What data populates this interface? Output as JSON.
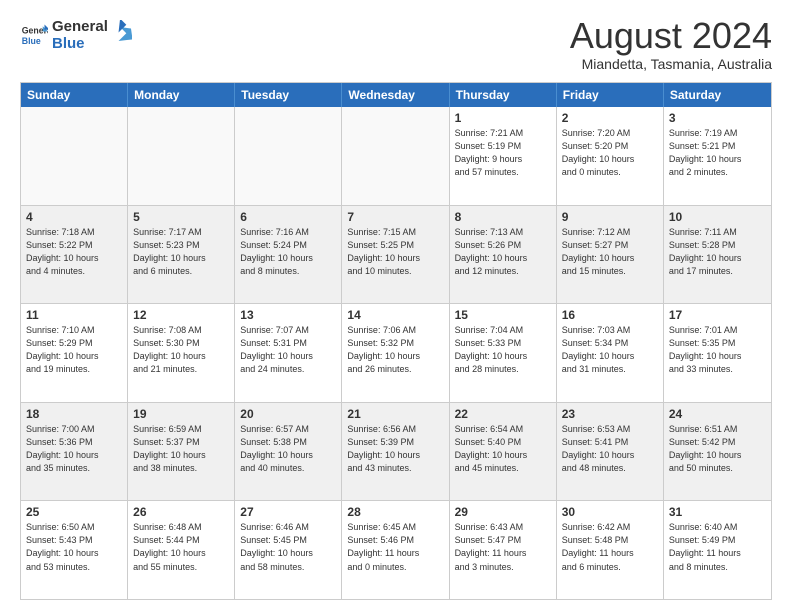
{
  "header": {
    "logo_line1": "General",
    "logo_line2": "Blue",
    "month_title": "August 2024",
    "location": "Miandetta, Tasmania, Australia"
  },
  "days_of_week": [
    "Sunday",
    "Monday",
    "Tuesday",
    "Wednesday",
    "Thursday",
    "Friday",
    "Saturday"
  ],
  "weeks": [
    [
      {
        "day": "",
        "text": ""
      },
      {
        "day": "",
        "text": ""
      },
      {
        "day": "",
        "text": ""
      },
      {
        "day": "",
        "text": ""
      },
      {
        "day": "1",
        "text": "Sunrise: 7:21 AM\nSunset: 5:19 PM\nDaylight: 9 hours\nand 57 minutes."
      },
      {
        "day": "2",
        "text": "Sunrise: 7:20 AM\nSunset: 5:20 PM\nDaylight: 10 hours\nand 0 minutes."
      },
      {
        "day": "3",
        "text": "Sunrise: 7:19 AM\nSunset: 5:21 PM\nDaylight: 10 hours\nand 2 minutes."
      }
    ],
    [
      {
        "day": "4",
        "text": "Sunrise: 7:18 AM\nSunset: 5:22 PM\nDaylight: 10 hours\nand 4 minutes."
      },
      {
        "day": "5",
        "text": "Sunrise: 7:17 AM\nSunset: 5:23 PM\nDaylight: 10 hours\nand 6 minutes."
      },
      {
        "day": "6",
        "text": "Sunrise: 7:16 AM\nSunset: 5:24 PM\nDaylight: 10 hours\nand 8 minutes."
      },
      {
        "day": "7",
        "text": "Sunrise: 7:15 AM\nSunset: 5:25 PM\nDaylight: 10 hours\nand 10 minutes."
      },
      {
        "day": "8",
        "text": "Sunrise: 7:13 AM\nSunset: 5:26 PM\nDaylight: 10 hours\nand 12 minutes."
      },
      {
        "day": "9",
        "text": "Sunrise: 7:12 AM\nSunset: 5:27 PM\nDaylight: 10 hours\nand 15 minutes."
      },
      {
        "day": "10",
        "text": "Sunrise: 7:11 AM\nSunset: 5:28 PM\nDaylight: 10 hours\nand 17 minutes."
      }
    ],
    [
      {
        "day": "11",
        "text": "Sunrise: 7:10 AM\nSunset: 5:29 PM\nDaylight: 10 hours\nand 19 minutes."
      },
      {
        "day": "12",
        "text": "Sunrise: 7:08 AM\nSunset: 5:30 PM\nDaylight: 10 hours\nand 21 minutes."
      },
      {
        "day": "13",
        "text": "Sunrise: 7:07 AM\nSunset: 5:31 PM\nDaylight: 10 hours\nand 24 minutes."
      },
      {
        "day": "14",
        "text": "Sunrise: 7:06 AM\nSunset: 5:32 PM\nDaylight: 10 hours\nand 26 minutes."
      },
      {
        "day": "15",
        "text": "Sunrise: 7:04 AM\nSunset: 5:33 PM\nDaylight: 10 hours\nand 28 minutes."
      },
      {
        "day": "16",
        "text": "Sunrise: 7:03 AM\nSunset: 5:34 PM\nDaylight: 10 hours\nand 31 minutes."
      },
      {
        "day": "17",
        "text": "Sunrise: 7:01 AM\nSunset: 5:35 PM\nDaylight: 10 hours\nand 33 minutes."
      }
    ],
    [
      {
        "day": "18",
        "text": "Sunrise: 7:00 AM\nSunset: 5:36 PM\nDaylight: 10 hours\nand 35 minutes."
      },
      {
        "day": "19",
        "text": "Sunrise: 6:59 AM\nSunset: 5:37 PM\nDaylight: 10 hours\nand 38 minutes."
      },
      {
        "day": "20",
        "text": "Sunrise: 6:57 AM\nSunset: 5:38 PM\nDaylight: 10 hours\nand 40 minutes."
      },
      {
        "day": "21",
        "text": "Sunrise: 6:56 AM\nSunset: 5:39 PM\nDaylight: 10 hours\nand 43 minutes."
      },
      {
        "day": "22",
        "text": "Sunrise: 6:54 AM\nSunset: 5:40 PM\nDaylight: 10 hours\nand 45 minutes."
      },
      {
        "day": "23",
        "text": "Sunrise: 6:53 AM\nSunset: 5:41 PM\nDaylight: 10 hours\nand 48 minutes."
      },
      {
        "day": "24",
        "text": "Sunrise: 6:51 AM\nSunset: 5:42 PM\nDaylight: 10 hours\nand 50 minutes."
      }
    ],
    [
      {
        "day": "25",
        "text": "Sunrise: 6:50 AM\nSunset: 5:43 PM\nDaylight: 10 hours\nand 53 minutes."
      },
      {
        "day": "26",
        "text": "Sunrise: 6:48 AM\nSunset: 5:44 PM\nDaylight: 10 hours\nand 55 minutes."
      },
      {
        "day": "27",
        "text": "Sunrise: 6:46 AM\nSunset: 5:45 PM\nDaylight: 10 hours\nand 58 minutes."
      },
      {
        "day": "28",
        "text": "Sunrise: 6:45 AM\nSunset: 5:46 PM\nDaylight: 11 hours\nand 0 minutes."
      },
      {
        "day": "29",
        "text": "Sunrise: 6:43 AM\nSunset: 5:47 PM\nDaylight: 11 hours\nand 3 minutes."
      },
      {
        "day": "30",
        "text": "Sunrise: 6:42 AM\nSunset: 5:48 PM\nDaylight: 11 hours\nand 6 minutes."
      },
      {
        "day": "31",
        "text": "Sunrise: 6:40 AM\nSunset: 5:49 PM\nDaylight: 11 hours\nand 8 minutes."
      }
    ]
  ],
  "alt_rows": [
    1,
    3
  ]
}
